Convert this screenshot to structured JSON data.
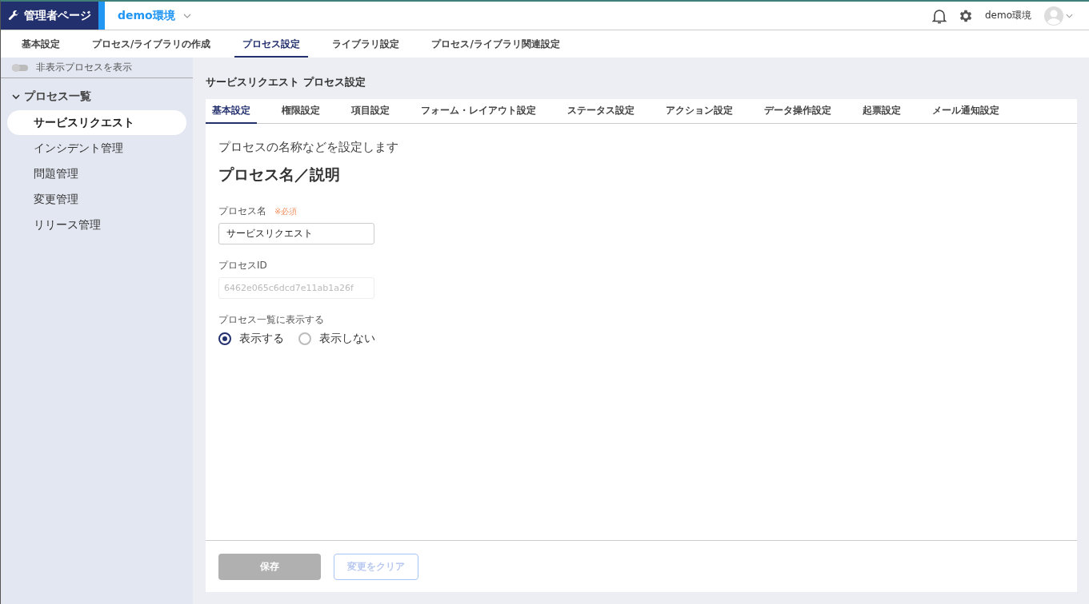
{
  "header": {
    "badge": "管理者ページ",
    "environment": "demo環境",
    "user": "demo環境"
  },
  "nav_tabs": [
    {
      "label": "基本設定",
      "selected": false
    },
    {
      "label": "プロセス/ライブラリの作成",
      "selected": false
    },
    {
      "label": "プロセス設定",
      "selected": true
    },
    {
      "label": "ライブラリ設定",
      "selected": false
    },
    {
      "label": "プロセス/ライブラリ関連設定",
      "selected": false
    }
  ],
  "sidebar": {
    "toggle": {
      "label": "非表示プロセスを表示",
      "on": false
    },
    "group": {
      "label": "プロセス一覧",
      "expanded": true,
      "items": [
        {
          "label": "サービスリクエスト",
          "selected": true
        },
        {
          "label": "インシデント管理",
          "selected": false
        },
        {
          "label": "問題管理",
          "selected": false
        },
        {
          "label": "変更管理",
          "selected": false
        },
        {
          "label": "リリース管理",
          "selected": false
        }
      ]
    }
  },
  "page_title": "サービスリクエスト プロセス設定",
  "sub_tabs": [
    {
      "label": "基本設定",
      "selected": true
    },
    {
      "label": "権限設定",
      "selected": false
    },
    {
      "label": "項目設定",
      "selected": false
    },
    {
      "label": "フォーム・レイアウト設定",
      "selected": false
    },
    {
      "label": "ステータス設定",
      "selected": false
    },
    {
      "label": "アクション設定",
      "selected": false
    },
    {
      "label": "データ操作設定",
      "selected": false
    },
    {
      "label": "起票設定",
      "selected": false
    },
    {
      "label": "メール通知設定",
      "selected": false
    }
  ],
  "description": "プロセスの名称などを設定します",
  "section_title": "プロセス名／説明",
  "fields": [
    {
      "label": "プロセス名",
      "required_note": "※必須",
      "value": "サービスリクエスト",
      "disabled": false
    },
    {
      "label": "プロセスID",
      "value": "6462e065c6dcd7e11ab1a26f",
      "disabled": true
    }
  ],
  "visibility": {
    "label": "プロセス一覧に表示する",
    "options": [
      {
        "label": "表示する",
        "selected": true
      },
      {
        "label": "表示しない",
        "selected": false
      }
    ]
  },
  "buttons": [
    {
      "label": "保存",
      "kind": "primary",
      "disabled": true
    },
    {
      "label": "変更をクリア",
      "kind": "secondary",
      "disabled": true
    }
  ]
}
